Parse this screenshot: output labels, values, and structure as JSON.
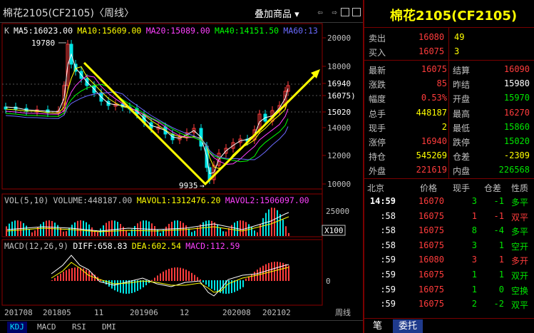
{
  "header": {
    "title": "棉花2105(CF2105)〈周线〉",
    "overlay_button": "叠加商品 ▾",
    "nav_icons": [
      "left-arrow-icon",
      "right-arrow-icon",
      "chart-icon",
      "grid-icon"
    ]
  },
  "main_chart": {
    "legend": [
      {
        "text": "K",
        "color": "#c0c0c0"
      },
      {
        "text": "MA5:16023.00",
        "color": "#ffffff"
      },
      {
        "text": "MA10:15609.00",
        "color": "#ffff00"
      },
      {
        "text": "MA20:15089.00",
        "color": "#ff40ff"
      },
      {
        "text": "MA40:14151.50",
        "color": "#00ff00"
      },
      {
        "text": "MA60:13",
        "color": "#6a6aff"
      }
    ],
    "y_ticks": [
      "20000",
      "18000",
      "16940",
      "16075)",
      "15020",
      "14000",
      "12000",
      "10000"
    ],
    "high_label": "19780",
    "low_label": "9935",
    "low_arrow": "→"
  },
  "volume_panel": {
    "legend": [
      {
        "text": "VOL(5,10)",
        "color": "#c0c0c0"
      },
      {
        "text": "VOLUME:448187.00",
        "color": "#c0c0c0"
      },
      {
        "text": "MAVOL1:1312476.20",
        "color": "#ffff00"
      },
      {
        "text": "MAVOL2:1506097.00",
        "color": "#ff40ff"
      }
    ],
    "y_ticks": [
      "25000",
      "X100"
    ]
  },
  "macd_panel": {
    "legend": [
      {
        "text": "MACD(12,26,9)",
        "color": "#c0c0c0"
      },
      {
        "text": "DIFF:658.83",
        "color": "#ffffff"
      },
      {
        "text": "DEA:602.54",
        "color": "#ffff00"
      },
      {
        "text": "MACD:112.59",
        "color": "#ff40ff"
      }
    ],
    "y_ticks": [
      "0"
    ]
  },
  "x_axis": {
    "labels": [
      "201708",
      "201805",
      "11",
      "201906",
      "12",
      "202008",
      "202102"
    ],
    "period": "周线"
  },
  "indicator_tabs": [
    "KDJ",
    "MACD",
    "RSI",
    "DMI"
  ],
  "quote": {
    "title": "棉花2105(CF2105)",
    "ask": {
      "label": "卖出",
      "price": "16080",
      "vol": "49"
    },
    "bid": {
      "label": "买入",
      "price": "16075",
      "vol": "3"
    },
    "rows": [
      {
        "l1": "最新",
        "v1": "16075",
        "c1": "red",
        "l2": "结算",
        "v2": "16090",
        "c2": "red"
      },
      {
        "l1": "涨跌",
        "v1": "85",
        "c1": "red",
        "l2": "昨结",
        "v2": "15980",
        "c2": "white"
      },
      {
        "l1": "幅度",
        "v1": "0.53%",
        "c1": "red",
        "l2": "开盘",
        "v2": "15970",
        "c2": "green"
      },
      {
        "l1": "总手",
        "v1": "448187",
        "c1": "yellow",
        "l2": "最高",
        "v2": "16270",
        "c2": "red"
      },
      {
        "l1": "现手",
        "v1": "2",
        "c1": "yellow",
        "l2": "最低",
        "v2": "15860",
        "c2": "green"
      },
      {
        "l1": "涨停",
        "v1": "16940",
        "c1": "red",
        "l2": "跌停",
        "v2": "15020",
        "c2": "green"
      },
      {
        "l1": "持仓",
        "v1": "545269",
        "c1": "yellow",
        "l2": "仓差",
        "v2": "-2309",
        "c2": "yellow"
      },
      {
        "l1": "外盘",
        "v1": "221619",
        "c1": "red",
        "l2": "内盘",
        "v2": "226568",
        "c2": "green"
      }
    ],
    "ticks_header": [
      "北京",
      "价格",
      "现手",
      "仓差",
      "性质"
    ],
    "ticks": [
      {
        "time": "14:59",
        "price": "16070",
        "pc": "red",
        "vol": "3",
        "vc": "green",
        "diff": "-1",
        "nature": "多平",
        "nc": "green"
      },
      {
        "time": ":58",
        "price": "16075",
        "pc": "red",
        "vol": "1",
        "vc": "red",
        "diff": "-1",
        "nature": "双平",
        "nc": "red"
      },
      {
        "time": ":58",
        "price": "16075",
        "pc": "red",
        "vol": "8",
        "vc": "green",
        "diff": "-4",
        "nature": "多平",
        "nc": "green"
      },
      {
        "time": ":58",
        "price": "16075",
        "pc": "red",
        "vol": "3",
        "vc": "green",
        "diff": "1",
        "nature": "空开",
        "nc": "green"
      },
      {
        "time": ":59",
        "price": "16080",
        "pc": "red",
        "vol": "3",
        "vc": "red",
        "diff": "1",
        "nature": "多开",
        "nc": "red"
      },
      {
        "time": ":59",
        "price": "16075",
        "pc": "red",
        "vol": "1",
        "vc": "green",
        "diff": "1",
        "nature": "双开",
        "nc": "green"
      },
      {
        "time": ":59",
        "price": "16075",
        "pc": "red",
        "vol": "1",
        "vc": "green",
        "diff": "0",
        "nature": "空换",
        "nc": "green"
      },
      {
        "time": ":59",
        "price": "16075",
        "pc": "red",
        "vol": "2",
        "vc": "green",
        "diff": "-2",
        "nature": "双平",
        "nc": "green"
      }
    ],
    "tabs": [
      "笔",
      "委托"
    ]
  }
}
